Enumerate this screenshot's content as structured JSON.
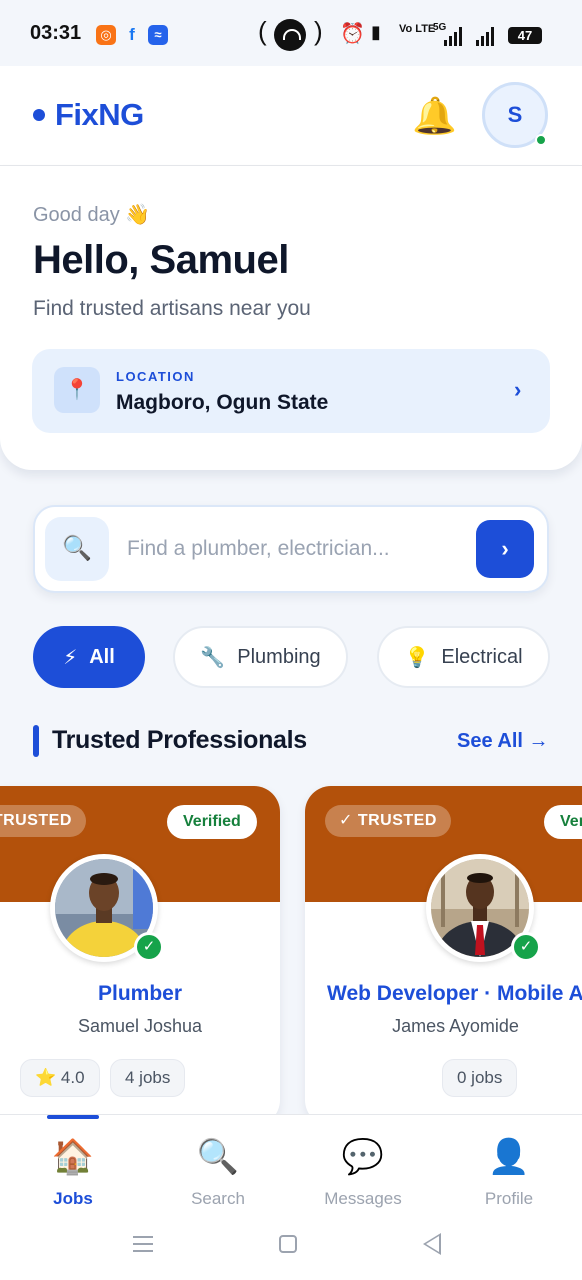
{
  "status_bar": {
    "time": "03:31",
    "network_label": "Vo LTE",
    "network_type": "5G",
    "battery": "47"
  },
  "header": {
    "logo": "FixNG",
    "avatar_initial": "S",
    "brand_color": "#1d4ed8"
  },
  "hero": {
    "greeting": "Good day 👋",
    "hello": "Hello, Samuel",
    "tagline": "Find trusted artisans near you",
    "location_label": "LOCATION",
    "location_value": "Magboro, Ogun State"
  },
  "search": {
    "placeholder": "Find a plumber, electrician..."
  },
  "categories": [
    {
      "label": "All",
      "icon": "lightning-icon",
      "active": true
    },
    {
      "label": "Plumbing",
      "icon": "wrench-icon",
      "active": false
    },
    {
      "label": "Electrical",
      "icon": "lightbulb-icon",
      "active": false
    }
  ],
  "section": {
    "title": "Trusted Professionals",
    "see_all": "See All →"
  },
  "professionals": [
    {
      "trusted": "✓ TRUSTED",
      "verified": "Verified",
      "role": "Plumber",
      "name": "Samuel Joshua",
      "rating": "4.0",
      "jobs": "4 jobs",
      "banner_color": "#b3510b"
    },
    {
      "trusted": "✓ TRUSTED",
      "verified": "Verified",
      "role": "Web Developer · Mobile App Developer",
      "name": "James Ayomide",
      "jobs": "0 jobs",
      "banner_color": "#b3510b"
    }
  ],
  "bottom_nav": [
    {
      "label": "Jobs",
      "icon": "home-icon",
      "active": true
    },
    {
      "label": "Search",
      "icon": "search-icon",
      "active": false
    },
    {
      "label": "Messages",
      "icon": "chat-icon",
      "active": false
    },
    {
      "label": "Profile",
      "icon": "person-icon",
      "active": false
    }
  ]
}
